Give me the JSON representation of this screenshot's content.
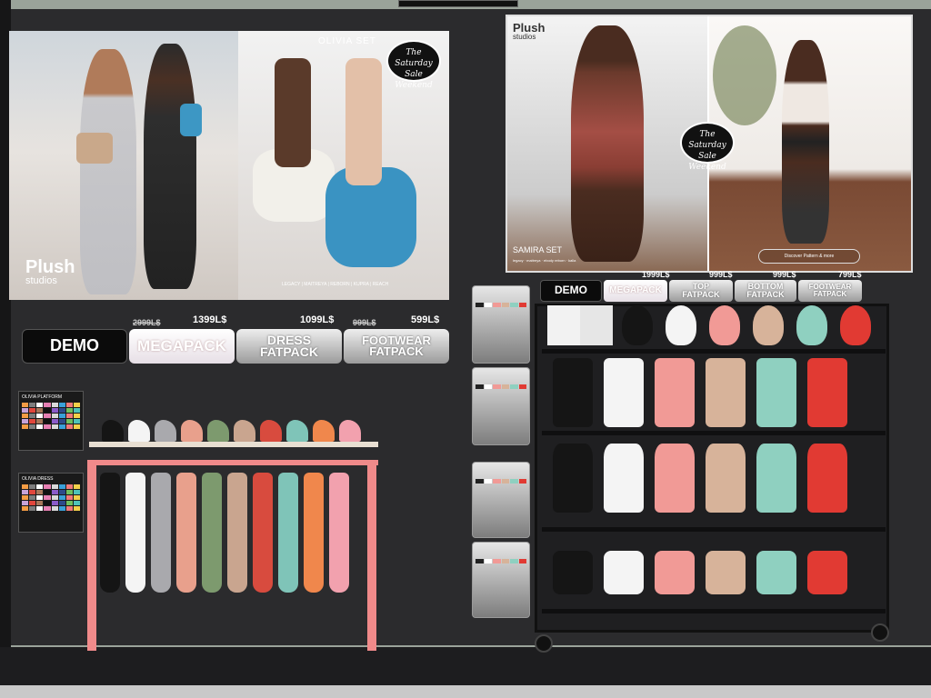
{
  "olivia_poster": {
    "set_title": "OLIVIA SET",
    "brand": "Plush",
    "brand_sub": "studios",
    "badge": "The Saturday Sale Weekend",
    "footer": "LEGACY | MAITREYA | REBORN | KUPRA | REACH"
  },
  "samira_poster": {
    "brand": "Plush",
    "brand_sub": "studios",
    "badge": "The Saturday Sale Weekend",
    "set_title": "SAMIRA SET",
    "set_sub": "legacy · maitreya · ebody reborn · kalla",
    "button": "Discover Pattern & more"
  },
  "olivia_buttons": {
    "demo": "DEMO",
    "megapack": "MEGAPACK",
    "dress": "DRESS FATPACK",
    "footwear": "FOOTWEAR FATPACK",
    "mega_old_price": "2999L$",
    "mega_price": "1399L$",
    "dress_price": "1099L$",
    "foot_old_price": "999L$",
    "foot_price": "599L$"
  },
  "samira_buttons": {
    "demo": "DEMO",
    "megapack": "MEGAPACK",
    "top": "TOP FATPACK",
    "bottom": "BOTTOM FATPACK",
    "footwear": "FOOTWEAR FATPACK",
    "mega_price": "1999L$",
    "top_price": "999L$",
    "bottom_price": "999L$",
    "foot_price": "799L$"
  },
  "swatch_panels": {
    "platform": "OLIVIA PLATFORM",
    "dress": "OLIVIA DRESS"
  },
  "colors": {
    "olivia": [
      "#151515",
      "#f4f4f4",
      "#a9a9ad",
      "#e8a08c",
      "#7d9a6e",
      "#c9a58f",
      "#d84b3e",
      "#7fc4b8",
      "#f0874c",
      "#f2a1ae"
    ],
    "samira": [
      "#151515",
      "#f4f4f4",
      "#f19a96",
      "#d7b39a",
      "#8fd0c0",
      "#e13a33"
    ]
  }
}
